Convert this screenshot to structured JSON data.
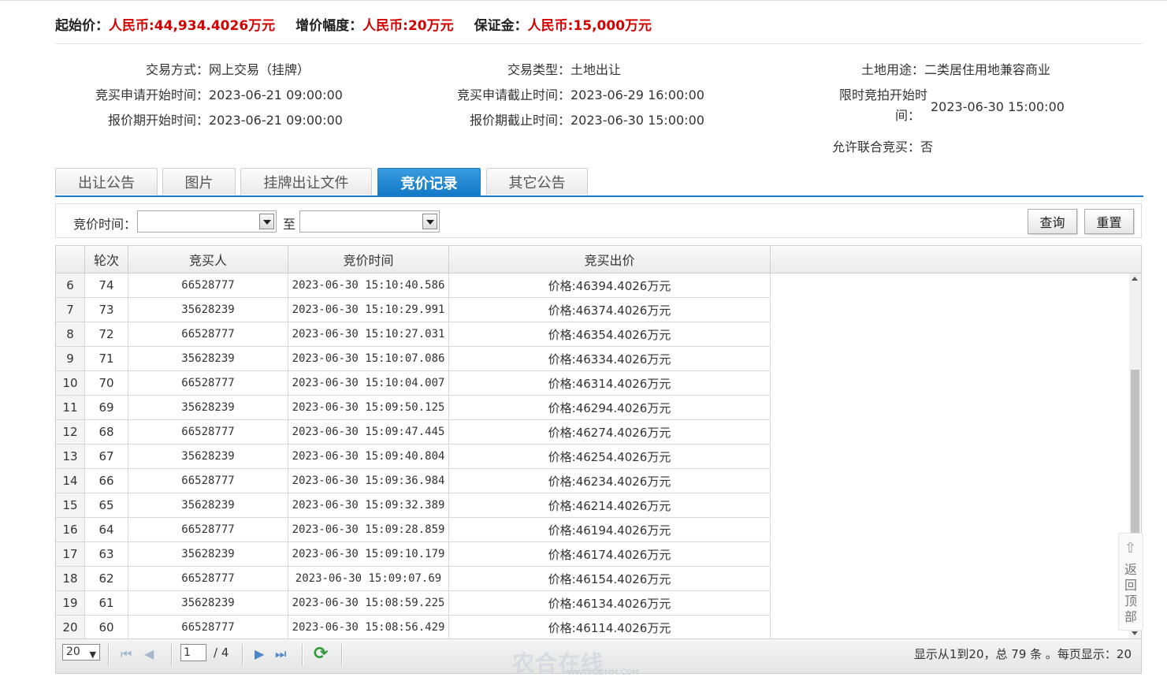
{
  "price_bar": {
    "start_price_label": "起始价：",
    "start_price_value": "人民币:44,934.4026万元",
    "increment_label": "增价幅度：",
    "increment_value": "人民币:20万元",
    "deposit_label": "保证金：",
    "deposit_value": "人民币:15,000万元"
  },
  "info": {
    "trade_mode_label": "交易方式：",
    "trade_mode_value": "网上交易（挂牌）",
    "trade_type_label": "交易类型：",
    "trade_type_value": "土地出让",
    "land_use_label": "土地用途：",
    "land_use_value": "二类居住用地兼容商业",
    "apply_start_label": "竞买申请开始时间：",
    "apply_start_value": "2023-06-21 09:00:00",
    "apply_end_label": "竞买申请截止时间：",
    "apply_end_value": "2023-06-29 16:00:00",
    "limit_start_label_1": "限时竞拍开始时",
    "limit_start_label_2": "间：",
    "limit_start_value": "2023-06-30 15:00:00",
    "quote_start_label": "报价期开始时间：",
    "quote_start_value": "2023-06-21 09:00:00",
    "quote_end_label": "报价期截止时间：",
    "quote_end_value": "2023-06-30 15:00:00",
    "joint_label": "允许联合竞买：",
    "joint_value": "否"
  },
  "tabs": [
    "出让公告",
    "图片",
    "挂牌出让文件",
    "竞价记录",
    "其它公告"
  ],
  "filter": {
    "time_label": "竞价时间：",
    "to_label": "至",
    "query_button": "查询",
    "reset_button": "重置"
  },
  "table": {
    "columns": [
      "轮次",
      "竞买人",
      "竞价时间",
      "竞买出价"
    ],
    "rows": [
      {
        "n": "6",
        "round": "74",
        "bidder": "66528777",
        "time": "2023-06-30 15:10:40.586",
        "price": "价格:46394.4026万元"
      },
      {
        "n": "7",
        "round": "73",
        "bidder": "35628239",
        "time": "2023-06-30 15:10:29.991",
        "price": "价格:46374.4026万元"
      },
      {
        "n": "8",
        "round": "72",
        "bidder": "66528777",
        "time": "2023-06-30 15:10:27.031",
        "price": "价格:46354.4026万元"
      },
      {
        "n": "9",
        "round": "71",
        "bidder": "35628239",
        "time": "2023-06-30 15:10:07.086",
        "price": "价格:46334.4026万元"
      },
      {
        "n": "10",
        "round": "70",
        "bidder": "66528777",
        "time": "2023-06-30 15:10:04.007",
        "price": "价格:46314.4026万元"
      },
      {
        "n": "11",
        "round": "69",
        "bidder": "35628239",
        "time": "2023-06-30 15:09:50.125",
        "price": "价格:46294.4026万元"
      },
      {
        "n": "12",
        "round": "68",
        "bidder": "66528777",
        "time": "2023-06-30 15:09:47.445",
        "price": "价格:46274.4026万元"
      },
      {
        "n": "13",
        "round": "67",
        "bidder": "35628239",
        "time": "2023-06-30 15:09:40.804",
        "price": "价格:46254.4026万元"
      },
      {
        "n": "14",
        "round": "66",
        "bidder": "66528777",
        "time": "2023-06-30 15:09:36.984",
        "price": "价格:46234.4026万元"
      },
      {
        "n": "15",
        "round": "65",
        "bidder": "35628239",
        "time": "2023-06-30 15:09:32.389",
        "price": "价格:46214.4026万元"
      },
      {
        "n": "16",
        "round": "64",
        "bidder": "66528777",
        "time": "2023-06-30 15:09:28.859",
        "price": "价格:46194.4026万元"
      },
      {
        "n": "17",
        "round": "63",
        "bidder": "35628239",
        "time": "2023-06-30 15:09:10.179",
        "price": "价格:46174.4026万元"
      },
      {
        "n": "18",
        "round": "62",
        "bidder": "66528777",
        "time": "2023-06-30 15:09:07.69",
        "price": "价格:46154.4026万元"
      },
      {
        "n": "19",
        "round": "61",
        "bidder": "35628239",
        "time": "2023-06-30 15:08:59.225",
        "price": "价格:46134.4026万元"
      },
      {
        "n": "20",
        "round": "60",
        "bidder": "66528777",
        "time": "2023-06-30 15:08:56.429",
        "price": "价格:46114.4026万元"
      }
    ]
  },
  "pager": {
    "page_size": "20",
    "current_page": "1",
    "total_pages": "/ 4",
    "summary": "显示从1到20，总 79 条 。每页显示：20"
  },
  "back_to_top": "返回顶部",
  "watermark": "农合在线",
  "watermark_url": "WWW.GDMM.COM",
  "colors": {
    "accent": "#1a7fcc",
    "price_red": "#d40000"
  },
  "icons": [
    "first-page-icon",
    "prev-page-icon",
    "next-page-icon",
    "last-page-icon",
    "refresh-icon",
    "up-arrow-icon"
  ]
}
